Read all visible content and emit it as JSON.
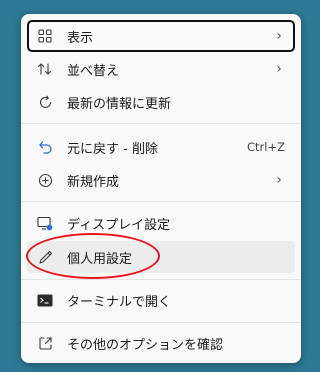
{
  "menu": {
    "items": [
      {
        "label": "表示",
        "icon": "view-grid-icon",
        "submenu": true
      },
      {
        "label": "並べ替え",
        "icon": "sort-icon",
        "submenu": true
      },
      {
        "label": "最新の情報に更新",
        "icon": "refresh-icon",
        "submenu": false
      },
      {
        "label": "元に戻す - 削除",
        "icon": "undo-icon",
        "shortcut": "Ctrl+Z"
      },
      {
        "label": "新規作成",
        "icon": "new-plus-icon",
        "submenu": true
      },
      {
        "label": "ディスプレイ設定",
        "icon": "display-settings-icon"
      },
      {
        "label": "個人用設定",
        "icon": "personalize-pen-icon"
      },
      {
        "label": "ターミナルで開く",
        "icon": "terminal-icon"
      },
      {
        "label": "その他のオプションを確認",
        "icon": "more-options-icon"
      }
    ]
  },
  "colors": {
    "desktop": "#2e7a96",
    "annotation": "#e8141c",
    "undo_icon": "#2a6fdb"
  }
}
